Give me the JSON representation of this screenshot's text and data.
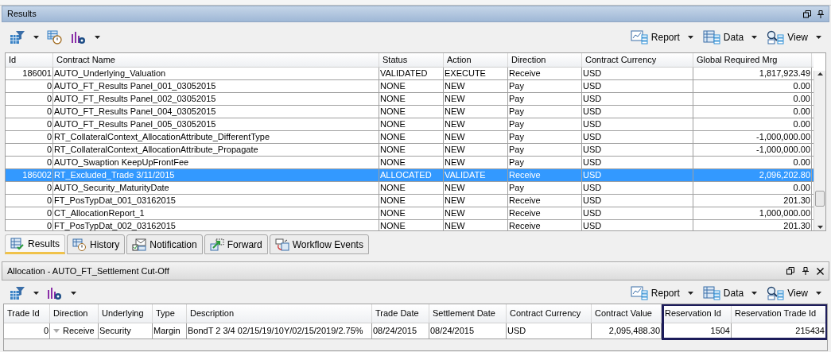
{
  "results_panel": {
    "title": "Results",
    "toolbar_right": [
      {
        "kind": "report",
        "label": "Report"
      },
      {
        "kind": "data",
        "label": "Data"
      },
      {
        "kind": "view",
        "label": "View"
      }
    ],
    "table": {
      "columns": [
        "Id",
        "Contract Name",
        "Status",
        "Action",
        "Direction",
        "Contract Currency",
        "Global Required Mrg"
      ],
      "rows": [
        {
          "cells": [
            "186001",
            "AUTO_Underlying_Valuation",
            "VALIDATED",
            "EXECUTE",
            "Receive",
            "USD",
            "1,817,923.49"
          ],
          "selected": false
        },
        {
          "cells": [
            "0",
            "AUTO_FT_Results Panel_001_03052015",
            "NONE",
            "NEW",
            "Pay",
            "USD",
            "0.00"
          ],
          "selected": false
        },
        {
          "cells": [
            "0",
            "AUTO_FT_Results Panel_002_03052015",
            "NONE",
            "NEW",
            "Pay",
            "USD",
            "0.00"
          ],
          "selected": false
        },
        {
          "cells": [
            "0",
            "AUTO_FT_Results Panel_004_03052015",
            "NONE",
            "NEW",
            "Pay",
            "USD",
            "0.00"
          ],
          "selected": false
        },
        {
          "cells": [
            "0",
            "AUTO_FT_Results Panel_005_03052015",
            "NONE",
            "NEW",
            "Pay",
            "USD",
            "0.00"
          ],
          "selected": false
        },
        {
          "cells": [
            "0",
            "RT_CollateralContext_AllocationAttribute_DifferentType",
            "NONE",
            "NEW",
            "Pay",
            "USD",
            "-1,000,000.00"
          ],
          "selected": false
        },
        {
          "cells": [
            "0",
            "RT_CollateralContext_AllocationAttribute_Propagate",
            "NONE",
            "NEW",
            "Pay",
            "USD",
            "-1,000,000.00"
          ],
          "selected": false
        },
        {
          "cells": [
            "0",
            "AUTO_Swaption KeepUpFrontFee",
            "NONE",
            "NEW",
            "Pay",
            "USD",
            "0.00"
          ],
          "selected": false
        },
        {
          "cells": [
            "186002",
            "RT_Excluded_Trade 3/11/2015",
            "ALLOCATED",
            "VALIDATE",
            "Receive",
            "USD",
            "2,096,202.80"
          ],
          "selected": true
        },
        {
          "cells": [
            "0",
            "AUTO_Security_MaturityDate",
            "NONE",
            "NEW",
            "Pay",
            "USD",
            "0.00"
          ],
          "selected": false
        },
        {
          "cells": [
            "0",
            "FT_PosTypDat_001_03162015",
            "NONE",
            "NEW",
            "Receive",
            "USD",
            "201.30"
          ],
          "selected": false
        },
        {
          "cells": [
            "0",
            "CT_AllocationReport_1",
            "NONE",
            "NEW",
            "Receive",
            "USD",
            "1,000,000.00"
          ],
          "selected": false
        },
        {
          "cells": [
            "0",
            "FT_PosTypDat_002_03162015",
            "NONE",
            "NEW",
            "Receive",
            "USD",
            "201.30"
          ],
          "selected": false
        }
      ]
    }
  },
  "tabs": [
    {
      "kind": "results",
      "label": "Results",
      "selected": true
    },
    {
      "kind": "history",
      "label": "History",
      "selected": false
    },
    {
      "kind": "notification",
      "label": "Notification",
      "selected": false
    },
    {
      "kind": "forward",
      "label": "Forward",
      "selected": false
    },
    {
      "kind": "workflow",
      "label": "Workflow Events",
      "selected": false
    }
  ],
  "allocation_panel": {
    "title": "Allocation - AUTO_FT_Settlement Cut-Off",
    "toolbar_right": [
      {
        "kind": "report",
        "label": "Report"
      },
      {
        "kind": "data",
        "label": "Data"
      },
      {
        "kind": "view",
        "label": "View"
      }
    ],
    "table": {
      "columns": [
        "Trade Id",
        "Direction",
        "Underlying",
        "Type",
        "Description",
        "Trade Date",
        "Settlement Date",
        "Contract Currency",
        "Contract Value",
        "Reservation Id",
        "Reservation Trade Id"
      ],
      "rows": [
        {
          "cells": [
            "0",
            "Receive",
            "Security",
            "Margin",
            "BondT 2 3/4 02/15/19/10Y/02/15/2019/2.75%",
            "08/24/2015",
            "08/24/2015",
            "USD",
            "2,095,488.30",
            "1504",
            "215434"
          ],
          "selected": false
        }
      ]
    }
  }
}
